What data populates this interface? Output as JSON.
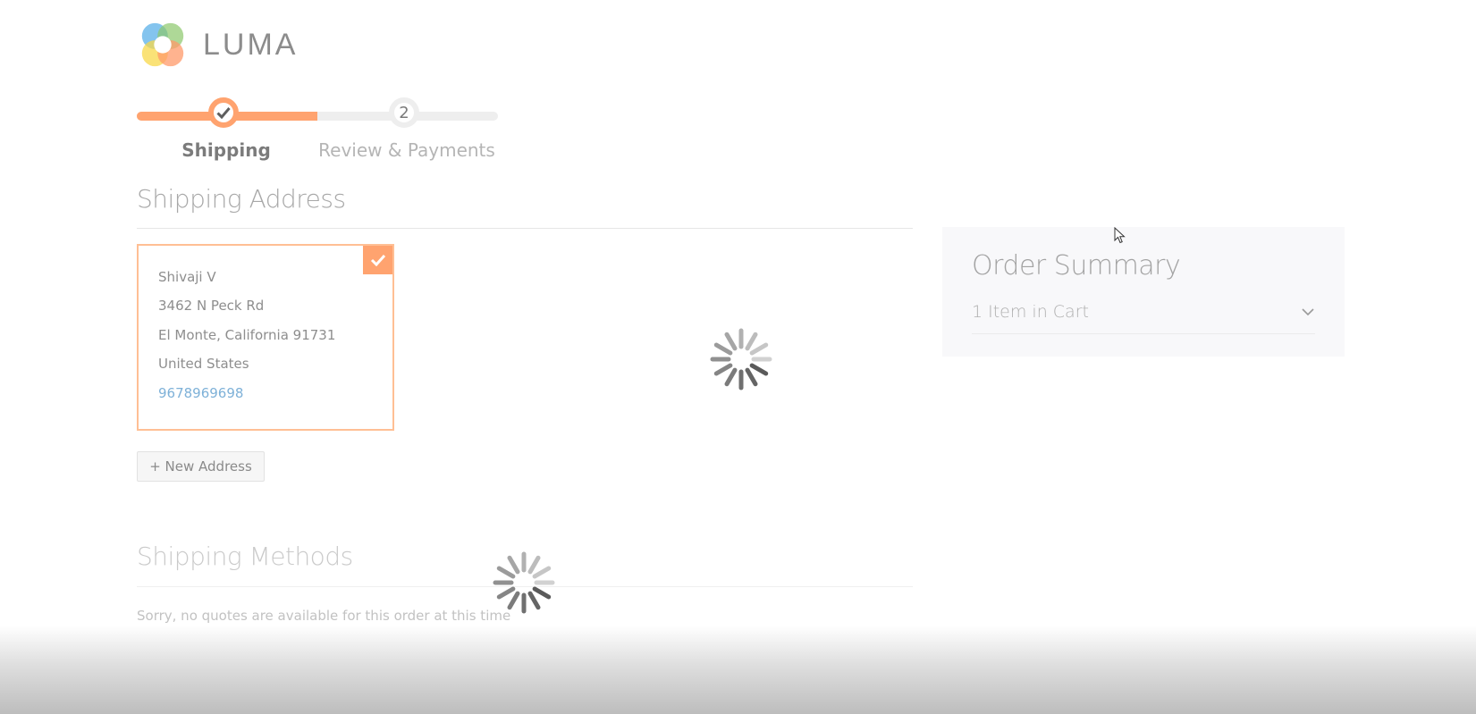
{
  "brand": {
    "name": "LUMA",
    "accent_color": "#ffa36f"
  },
  "progress": {
    "completed_fraction": 0.5,
    "steps": [
      {
        "number": "1",
        "label": "Shipping",
        "state": "complete"
      },
      {
        "number": "2",
        "label": "Review & Payments",
        "state": "pending"
      }
    ]
  },
  "shipping_address": {
    "title": "Shipping Address",
    "selected_address": {
      "name": "Shivaji V",
      "street": "3462 N Peck Rd",
      "city_region_zip": "El Monte, California 91731",
      "country": "United States",
      "phone": "9678969698"
    },
    "new_address_label": "+ New Address"
  },
  "shipping_methods": {
    "title": "Shipping Methods",
    "message": "Sorry, no quotes are available for this order at this time"
  },
  "order_summary": {
    "title": "Order Summary",
    "items_in_cart_label": "1 Item in Cart"
  },
  "loading": {
    "spinner_count": 2
  }
}
